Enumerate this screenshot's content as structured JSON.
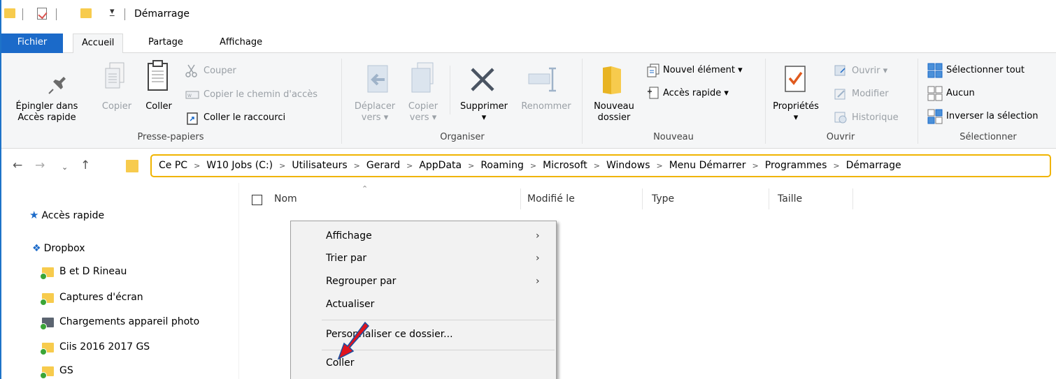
{
  "window": {
    "title": "Démarrage"
  },
  "tabs": [
    {
      "label": "Fichier"
    },
    {
      "label": "Accueil"
    },
    {
      "label": "Partage"
    },
    {
      "label": "Affichage"
    }
  ],
  "ribbon": {
    "clipboard": {
      "label": "Presse-papiers",
      "pin": "Épingler dans\nAccès rapide",
      "pin_l1": "Épingler dans",
      "pin_l2": "Accès rapide",
      "copy": "Copier",
      "paste": "Coller",
      "cut": "Couper",
      "copy_path": "Copier le chemin d'accès",
      "paste_shortcut": "Coller le raccourci"
    },
    "organize": {
      "label": "Organiser",
      "move_l1": "Déplacer",
      "move_l2": "vers",
      "copy_l1": "Copier",
      "copy_l2": "vers",
      "delete": "Supprimer",
      "rename": "Renommer"
    },
    "new": {
      "label": "Nouveau",
      "folder_l1": "Nouveau",
      "folder_l2": "dossier",
      "new_item": "Nouvel élément",
      "easy_access": "Accès rapide"
    },
    "open": {
      "label": "Ouvrir",
      "properties": "Propriétés",
      "open": "Ouvrir",
      "edit": "Modifier",
      "history": "Historique"
    },
    "select": {
      "label": "Sélectionner",
      "select_all": "Sélectionner tout",
      "select_none": "Aucun",
      "invert": "Inverser la sélection"
    }
  },
  "breadcrumb": [
    "Ce PC",
    "W10 Jobs (C:)",
    "Utilisateurs",
    "Gerard",
    "AppData",
    "Roaming",
    "Microsoft",
    "Windows",
    "Menu Démarrer",
    "Programmes",
    "Démarrage"
  ],
  "columns": {
    "name": "Nom",
    "modified": "Modifié le",
    "type": "Type",
    "size": "Taille"
  },
  "nav": {
    "quick_access": "Accès rapide",
    "dropbox": "Dropbox",
    "folders": [
      "B et D Rineau",
      "Captures d'écran",
      "Chargements appareil photo",
      "Ciis 2016 2017 GS",
      "GS"
    ]
  },
  "context_menu": {
    "view": "Affichage",
    "sort": "Trier par",
    "group": "Regrouper par",
    "refresh": "Actualiser",
    "customize": "Personnaliser ce dossier...",
    "paste": "Coller"
  },
  "colors": {
    "accent": "#1b6ac9",
    "highlight": "#f0b400",
    "annotation": "#e0141e"
  }
}
